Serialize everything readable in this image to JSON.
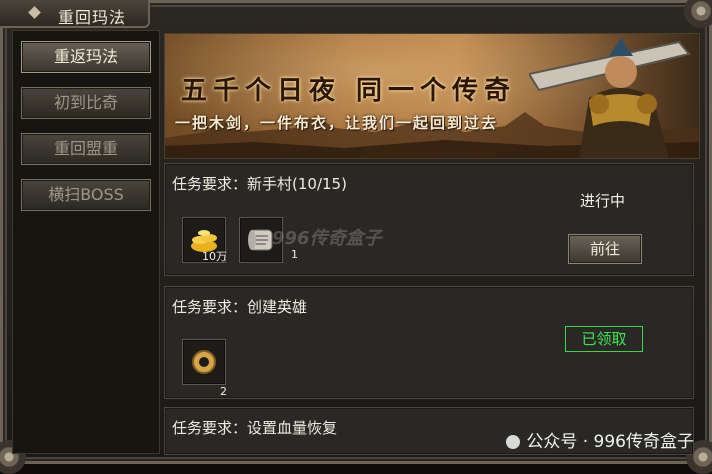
{
  "window": {
    "title": "重回玛法"
  },
  "sidebar": {
    "items": [
      {
        "label": "重返玛法",
        "active": true
      },
      {
        "label": "初到比奇",
        "active": false
      },
      {
        "label": "重回盟重",
        "active": false
      },
      {
        "label": "横扫BOSS",
        "active": false
      }
    ]
  },
  "banner": {
    "headline": "五千个日夜 同一个传奇",
    "subline": "一把木剑，一件布衣，让我们一起回到过去"
  },
  "tasks": [
    {
      "requirement": "任务要求：新手村(10/15)",
      "status": "进行中",
      "button": "前往",
      "rewards": [
        {
          "icon": "gold-coins-icon",
          "count": "10万"
        },
        {
          "icon": "scroll-icon",
          "count": "1"
        }
      ]
    },
    {
      "requirement": "任务要求：创建英雄",
      "status": "已领取",
      "rewards": [
        {
          "icon": "gold-ring-icon",
          "count": "2"
        }
      ]
    },
    {
      "requirement": "任务要求：设置血量恢复"
    }
  ],
  "overlays": {
    "center_watermark": "996传奇盒子",
    "credit": "公众号 · 996传奇盒子"
  },
  "colors": {
    "claimed_green": "#3de552",
    "panel_bg": "#2a2824",
    "frame": "#6b6358"
  }
}
